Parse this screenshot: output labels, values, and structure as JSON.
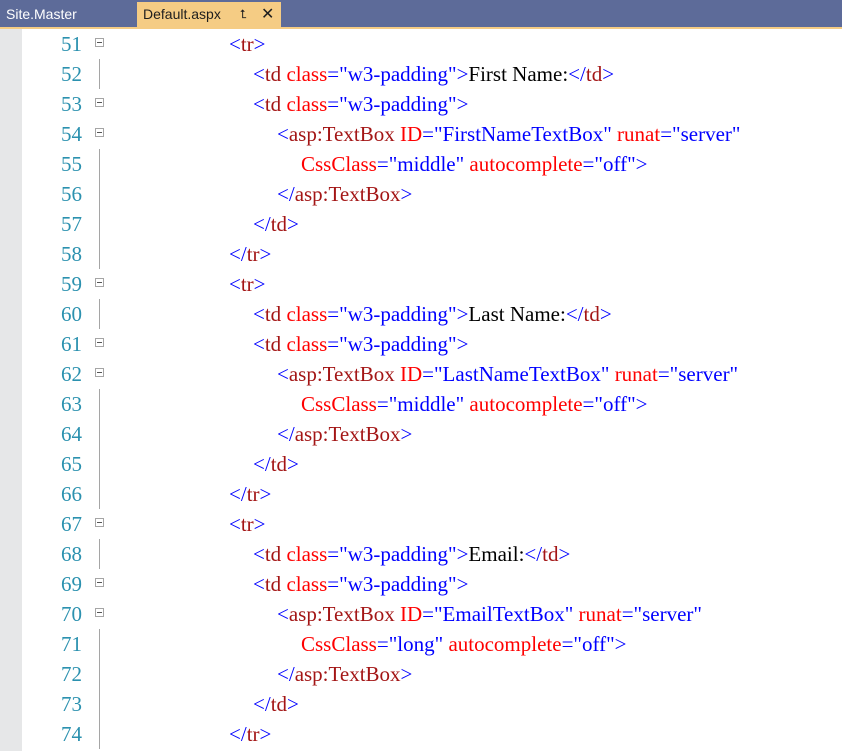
{
  "tabs": [
    {
      "label": "Site.Master",
      "active": false
    },
    {
      "label": "Default.aspx",
      "active": true,
      "pin_icon": "pin-icon",
      "close_icon": "close-icon"
    }
  ],
  "colors": {
    "tabbar": "#5d6b99",
    "active_tab": "#f5cc84",
    "line_number": "#2b91af",
    "delimiter": "#0000ff",
    "element_name": "#a31515",
    "attribute_name": "#ff0000",
    "attribute_value": "#0000ff",
    "text": "#000000"
  },
  "editor": {
    "lines": [
      {
        "number": "51",
        "fold": true,
        "tokens": [
          [
            "b",
            "<"
          ],
          [
            "m",
            "tr"
          ],
          [
            "b",
            ">"
          ]
        ]
      },
      {
        "number": "52",
        "fold": false,
        "tokens": [
          [
            "b",
            "<"
          ],
          [
            "m",
            "td"
          ],
          [
            "k",
            " "
          ],
          [
            "r",
            "class"
          ],
          [
            "b",
            "=\"w3-padding\""
          ],
          [
            "b",
            ">"
          ],
          [
            "k",
            "First Name:"
          ],
          [
            "b",
            "</"
          ],
          [
            "m",
            "td"
          ],
          [
            "b",
            ">"
          ]
        ]
      },
      {
        "number": "53",
        "fold": true,
        "tokens": [
          [
            "b",
            "<"
          ],
          [
            "m",
            "td"
          ],
          [
            "k",
            " "
          ],
          [
            "r",
            "class"
          ],
          [
            "b",
            "=\"w3-padding\""
          ],
          [
            "b",
            ">"
          ]
        ]
      },
      {
        "number": "54",
        "fold": true,
        "tokens": [
          [
            "b",
            "<"
          ],
          [
            "m",
            "asp:TextBox"
          ],
          [
            "k",
            " "
          ],
          [
            "r",
            "ID"
          ],
          [
            "b",
            "=\"FirstNameTextBox\""
          ],
          [
            "k",
            " "
          ],
          [
            "r",
            "runat"
          ],
          [
            "b",
            "=\"server\""
          ]
        ]
      },
      {
        "number": "55",
        "fold": false,
        "tokens": [
          [
            "r",
            "CssClass"
          ],
          [
            "b",
            "=\"middle\""
          ],
          [
            "k",
            " "
          ],
          [
            "r",
            "autocomplete"
          ],
          [
            "b",
            "=\"off\""
          ],
          [
            "b",
            ">"
          ]
        ]
      },
      {
        "number": "56",
        "fold": false,
        "tokens": [
          [
            "b",
            "</"
          ],
          [
            "m",
            "asp:TextBox"
          ],
          [
            "b",
            ">"
          ]
        ]
      },
      {
        "number": "57",
        "fold": false,
        "tokens": [
          [
            "b",
            "</"
          ],
          [
            "m",
            "td"
          ],
          [
            "b",
            ">"
          ]
        ]
      },
      {
        "number": "58",
        "fold": false,
        "tokens": [
          [
            "b",
            "</"
          ],
          [
            "m",
            "tr"
          ],
          [
            "b",
            ">"
          ]
        ]
      },
      {
        "number": "59",
        "fold": true,
        "tokens": [
          [
            "b",
            "<"
          ],
          [
            "m",
            "tr"
          ],
          [
            "b",
            ">"
          ]
        ]
      },
      {
        "number": "60",
        "fold": false,
        "tokens": [
          [
            "b",
            "<"
          ],
          [
            "m",
            "td"
          ],
          [
            "k",
            " "
          ],
          [
            "r",
            "class"
          ],
          [
            "b",
            "=\"w3-padding\""
          ],
          [
            "b",
            ">"
          ],
          [
            "k",
            "Last Name:"
          ],
          [
            "b",
            "</"
          ],
          [
            "m",
            "td"
          ],
          [
            "b",
            ">"
          ]
        ]
      },
      {
        "number": "61",
        "fold": true,
        "tokens": [
          [
            "b",
            "<"
          ],
          [
            "m",
            "td"
          ],
          [
            "k",
            " "
          ],
          [
            "r",
            "class"
          ],
          [
            "b",
            "=\"w3-padding\""
          ],
          [
            "b",
            ">"
          ]
        ]
      },
      {
        "number": "62",
        "fold": true,
        "tokens": [
          [
            "b",
            "<"
          ],
          [
            "m",
            "asp:TextBox"
          ],
          [
            "k",
            " "
          ],
          [
            "r",
            "ID"
          ],
          [
            "b",
            "=\"LastNameTextBox\""
          ],
          [
            "k",
            " "
          ],
          [
            "r",
            "runat"
          ],
          [
            "b",
            "=\"server\""
          ]
        ]
      },
      {
        "number": "63",
        "fold": false,
        "tokens": [
          [
            "r",
            "CssClass"
          ],
          [
            "b",
            "=\"middle\""
          ],
          [
            "k",
            " "
          ],
          [
            "r",
            "autocomplete"
          ],
          [
            "b",
            "=\"off\""
          ],
          [
            "b",
            ">"
          ]
        ]
      },
      {
        "number": "64",
        "fold": false,
        "tokens": [
          [
            "b",
            "</"
          ],
          [
            "m",
            "asp:TextBox"
          ],
          [
            "b",
            ">"
          ]
        ]
      },
      {
        "number": "65",
        "fold": false,
        "tokens": [
          [
            "b",
            "</"
          ],
          [
            "m",
            "td"
          ],
          [
            "b",
            ">"
          ]
        ]
      },
      {
        "number": "66",
        "fold": false,
        "tokens": [
          [
            "b",
            "</"
          ],
          [
            "m",
            "tr"
          ],
          [
            "b",
            ">"
          ]
        ]
      },
      {
        "number": "67",
        "fold": true,
        "tokens": [
          [
            "b",
            "<"
          ],
          [
            "m",
            "tr"
          ],
          [
            "b",
            ">"
          ]
        ]
      },
      {
        "number": "68",
        "fold": false,
        "tokens": [
          [
            "b",
            "<"
          ],
          [
            "m",
            "td"
          ],
          [
            "k",
            " "
          ],
          [
            "r",
            "class"
          ],
          [
            "b",
            "=\"w3-padding\""
          ],
          [
            "b",
            ">"
          ],
          [
            "k",
            "Email:"
          ],
          [
            "b",
            "</"
          ],
          [
            "m",
            "td"
          ],
          [
            "b",
            ">"
          ]
        ]
      },
      {
        "number": "69",
        "fold": true,
        "tokens": [
          [
            "b",
            "<"
          ],
          [
            "m",
            "td"
          ],
          [
            "k",
            " "
          ],
          [
            "r",
            "class"
          ],
          [
            "b",
            "=\"w3-padding\""
          ],
          [
            "b",
            ">"
          ]
        ]
      },
      {
        "number": "70",
        "fold": true,
        "tokens": [
          [
            "b",
            "<"
          ],
          [
            "m",
            "asp:TextBox"
          ],
          [
            "k",
            " "
          ],
          [
            "r",
            "ID"
          ],
          [
            "b",
            "=\"EmailTextBox\""
          ],
          [
            "k",
            " "
          ],
          [
            "r",
            "runat"
          ],
          [
            "b",
            "=\"server\""
          ]
        ]
      },
      {
        "number": "71",
        "fold": false,
        "tokens": [
          [
            "r",
            "CssClass"
          ],
          [
            "b",
            "=\"long\""
          ],
          [
            "k",
            " "
          ],
          [
            "r",
            "autocomplete"
          ],
          [
            "b",
            "=\"off\""
          ],
          [
            "b",
            ">"
          ]
        ]
      },
      {
        "number": "72",
        "fold": false,
        "tokens": [
          [
            "b",
            "</"
          ],
          [
            "m",
            "asp:TextBox"
          ],
          [
            "b",
            ">"
          ]
        ]
      },
      {
        "number": "73",
        "fold": false,
        "tokens": [
          [
            "b",
            "</"
          ],
          [
            "m",
            "td"
          ],
          [
            "b",
            ">"
          ]
        ]
      },
      {
        "number": "74",
        "fold": false,
        "tokens": [
          [
            "b",
            "</"
          ],
          [
            "m",
            "tr"
          ],
          [
            "b",
            ">"
          ]
        ]
      }
    ]
  }
}
